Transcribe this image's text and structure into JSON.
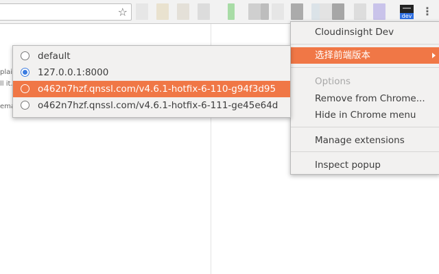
{
  "toolbar": {
    "bookmark_icon": "star-outline-icon",
    "menu_icon": "vertical-ellipsis-icon",
    "extension_badge": "dev",
    "extension_icons": [
      "#e6e6e6",
      "#e9e2cf",
      "#e4e0d8",
      "#dcdcdc",
      "#a8dca6",
      "#cfcfcf",
      "#bdbdbd",
      "#e6e6e6",
      "#ababab",
      "#dbe3e8",
      "#e3e3e3",
      "#a6a6a6",
      "#dddddd",
      "#c9c3ea"
    ]
  },
  "page": {
    "snippets": [
      "plai",
      "ll it.",
      "ema"
    ]
  },
  "context_menu": {
    "items": [
      {
        "label": "Cloudinsight Dev",
        "state": "normal"
      },
      {
        "label": "选择前端版本",
        "state": "highlighted",
        "has_submenu": true
      },
      {
        "label": "Options",
        "state": "disabled"
      },
      {
        "label": "Remove from Chrome...",
        "state": "normal"
      },
      {
        "label": "Hide in Chrome menu",
        "state": "normal"
      },
      {
        "label": "Manage extensions",
        "state": "normal"
      },
      {
        "label": "Inspect popup",
        "state": "normal"
      }
    ]
  },
  "submenu": {
    "items": [
      {
        "label": "default",
        "selected": false,
        "highlighted": false
      },
      {
        "label": "127.0.0.1:8000",
        "selected": true,
        "highlighted": false
      },
      {
        "label": "o462n7hzf.qnssl.com/v4.6.1-hotfix-6-110-g94f3d95",
        "selected": false,
        "highlighted": true
      },
      {
        "label": "o462n7hzf.qnssl.com/v4.6.1-hotfix-6-111-ge45e64d",
        "selected": false,
        "highlighted": false
      }
    ]
  },
  "colors": {
    "highlight": "#f07746",
    "radio_selected": "#3a7be0",
    "badge": "#2f6fe0"
  }
}
